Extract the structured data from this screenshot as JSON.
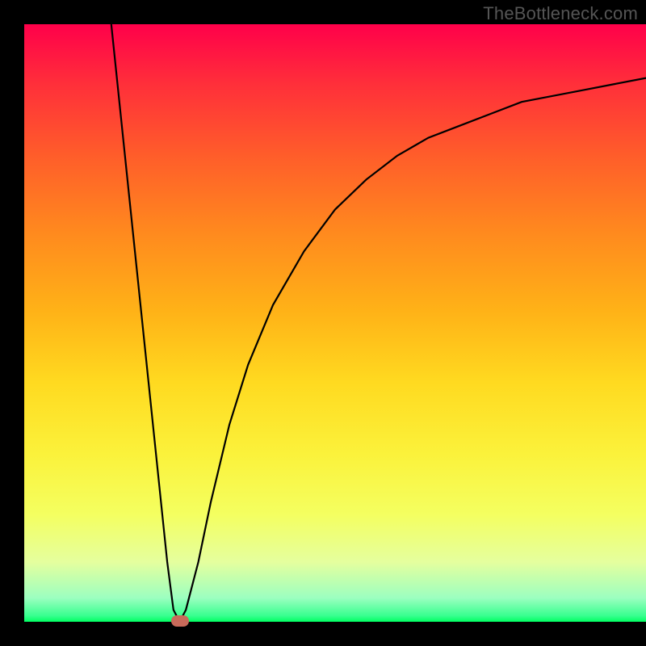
{
  "watermark": "TheBottleneck.com",
  "chart_data": {
    "type": "line",
    "title": "",
    "xlabel": "",
    "ylabel": "",
    "xlim": [
      0,
      100
    ],
    "ylim": [
      0,
      100
    ],
    "grid": false,
    "annotations": {
      "marker_point": {
        "x": 25,
        "y": 0,
        "color": "#c86a5a"
      }
    },
    "curve_points": [
      {
        "x": 14,
        "y": 100
      },
      {
        "x": 15,
        "y": 90
      },
      {
        "x": 16,
        "y": 80
      },
      {
        "x": 17,
        "y": 70
      },
      {
        "x": 18,
        "y": 60
      },
      {
        "x": 19,
        "y": 50
      },
      {
        "x": 20,
        "y": 40
      },
      {
        "x": 21,
        "y": 30
      },
      {
        "x": 22,
        "y": 20
      },
      {
        "x": 23,
        "y": 10
      },
      {
        "x": 24,
        "y": 2
      },
      {
        "x": 25,
        "y": 0
      },
      {
        "x": 26,
        "y": 2
      },
      {
        "x": 28,
        "y": 10
      },
      {
        "x": 30,
        "y": 20
      },
      {
        "x": 33,
        "y": 33
      },
      {
        "x": 36,
        "y": 43
      },
      {
        "x": 40,
        "y": 53
      },
      {
        "x": 45,
        "y": 62
      },
      {
        "x": 50,
        "y": 69
      },
      {
        "x": 55,
        "y": 74
      },
      {
        "x": 60,
        "y": 78
      },
      {
        "x": 65,
        "y": 81
      },
      {
        "x": 70,
        "y": 83
      },
      {
        "x": 75,
        "y": 85
      },
      {
        "x": 80,
        "y": 87
      },
      {
        "x": 85,
        "y": 88
      },
      {
        "x": 90,
        "y": 89
      },
      {
        "x": 95,
        "y": 90
      },
      {
        "x": 100,
        "y": 91
      }
    ],
    "background_gradient": {
      "top": "#ff004a",
      "middle": "#ffda20",
      "bottom": "#00ff62"
    }
  }
}
